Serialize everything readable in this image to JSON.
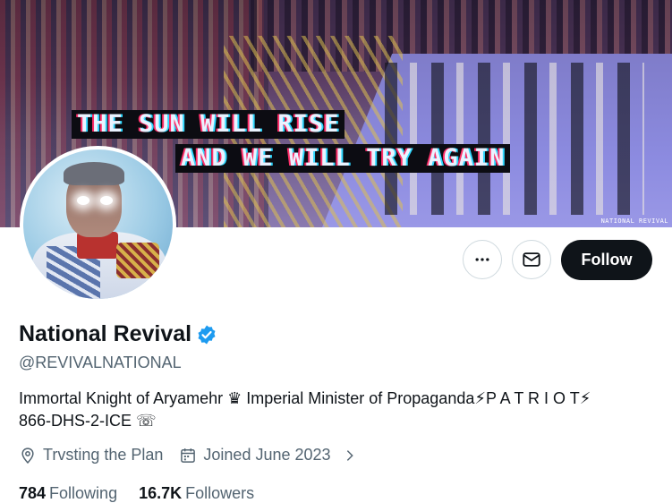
{
  "banner": {
    "line1": "THE SUN WILL RISE",
    "line2": "AND WE WILL TRY AGAIN",
    "watermark": "NATIONAL REVIVAL"
  },
  "actions": {
    "more_icon": "more-horizontal-icon",
    "message_icon": "envelope-icon",
    "follow_label": "Follow"
  },
  "profile": {
    "name": "National Revival",
    "verified_icon": "verified-badge-icon",
    "verified_color": "#1d9bf0",
    "handle": "@REVIVALNATIONAL",
    "bio_line1": "Immortal Knight of Aryamehr ♛ Imperial Minister of Propaganda⚡P A T R I O T⚡",
    "bio_line2": "866-DHS-2-ICE ☏",
    "location": "Trvsting the Plan",
    "location_icon": "location-pin-icon",
    "joined": "Joined June 2023",
    "joined_icon": "calendar-icon",
    "following_count": "784",
    "following_label": "Following",
    "followers_count": "16.7K",
    "followers_label": "Followers"
  },
  "colors": {
    "accent": "#0f1419",
    "muted": "#536471",
    "border": "#cfd9de"
  }
}
